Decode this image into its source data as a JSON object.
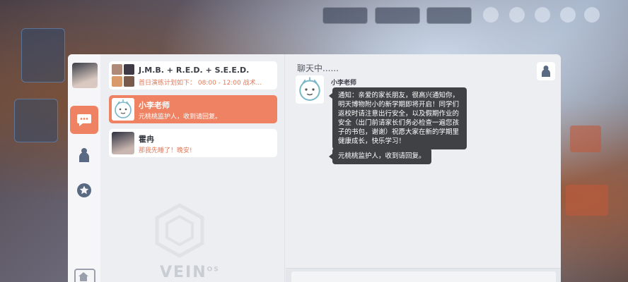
{
  "colors": {
    "accent": "#ee8262",
    "bubble": "#3f4145",
    "panel": "#eceef2"
  },
  "nav": {
    "items": [
      {
        "icon": "chat-icon",
        "active": true
      },
      {
        "icon": "contacts-icon",
        "active": false
      },
      {
        "icon": "star-icon",
        "active": false
      }
    ],
    "home_icon": "home-icon"
  },
  "brand": {
    "text": "VEIN",
    "superscript": "OS"
  },
  "conversations": [
    {
      "name": "J.M.B. + R.E.D. + S.E.E.D.",
      "snippet": "首日演练计划如下： 08:00 - 12:00 战术...",
      "active": false
    },
    {
      "name": "小李老师",
      "snippet": "元桃桃监护人，收到请回复。",
      "active": true
    },
    {
      "name": "霍冉",
      "snippet": "那我先睡了！晚安!",
      "active": false
    }
  ],
  "chat": {
    "title": "聊天中......",
    "sender": "小李老师",
    "messages": [
      "通知：亲爱的家长朋友，很高兴通知你，明天博物附小的新学期即将开启！同学们返校时请注意出行安全，以及假期作业的安全（出门前请家长们务必检查一遍您孩子的书包，谢谢）祝愿大家在新的学期里健康成长，快乐学习！",
      "元桃桃监护人，收到请回复。"
    ]
  }
}
